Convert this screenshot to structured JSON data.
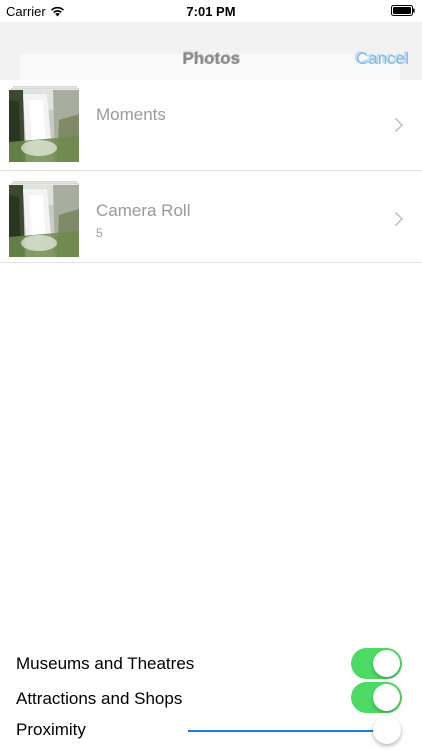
{
  "status_bar": {
    "carrier": "Carrier",
    "time": "7:01 PM"
  },
  "nav": {
    "title": "Photos",
    "cancel_label": "Cancel"
  },
  "albums": [
    {
      "title": "Moments",
      "count": ""
    },
    {
      "title": "Camera Roll",
      "count": "5"
    }
  ],
  "controls": {
    "toggles": [
      {
        "label": "Museums and Theatres",
        "on": true
      },
      {
        "label": "Attractions and Shops",
        "on": true
      }
    ],
    "slider": {
      "label": "Proximity",
      "value": 1.0
    }
  },
  "colors": {
    "toggle_on": "#4cd964",
    "slider_track": "#1f7fdc",
    "cancel_tint": "#7fb7ea"
  }
}
